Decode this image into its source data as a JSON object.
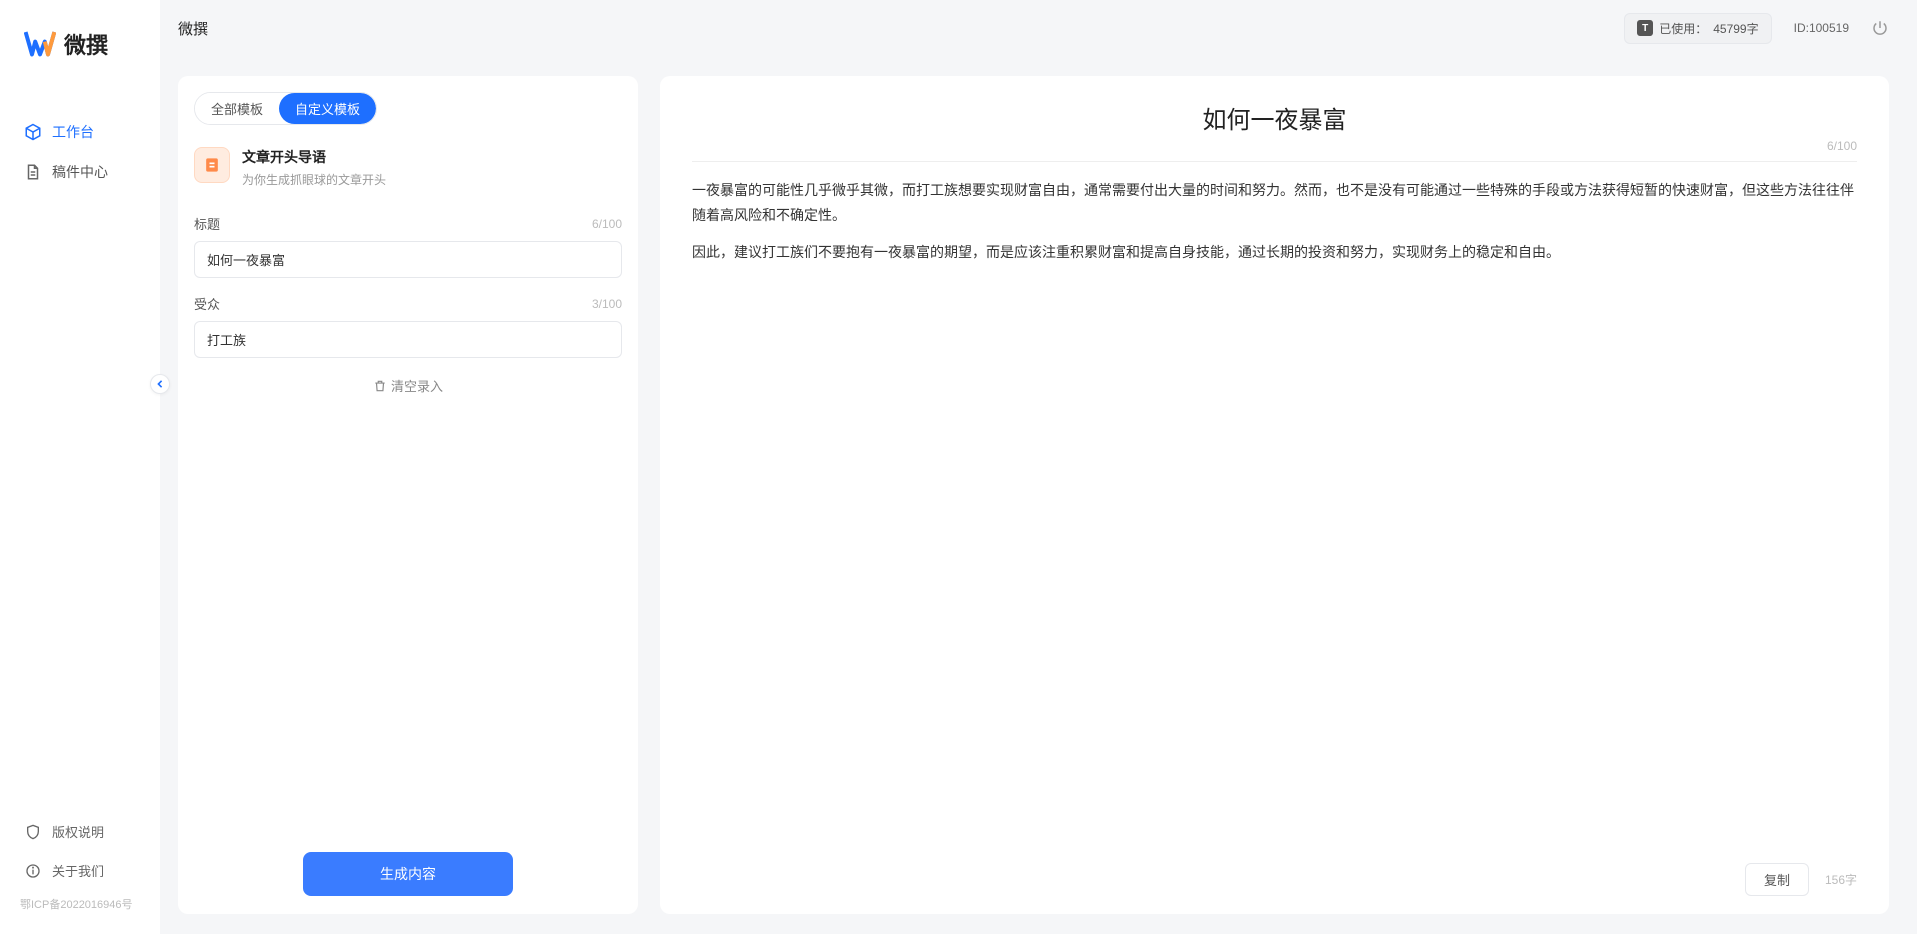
{
  "app_name": "微撰",
  "header": {
    "title": "微撰",
    "usage_label": "已使用：",
    "usage_value": "45799字",
    "user_id_label": "ID:",
    "user_id_value": "100519"
  },
  "sidebar": {
    "items": [
      {
        "label": "工作台",
        "icon": "cube",
        "active": true
      },
      {
        "label": "稿件中心",
        "icon": "document",
        "active": false
      }
    ],
    "bottom": [
      {
        "label": "版权说明",
        "icon": "shield"
      },
      {
        "label": "关于我们",
        "icon": "info"
      }
    ],
    "icp": "鄂ICP备2022016946号"
  },
  "left_panel": {
    "tabs": [
      {
        "label": "全部模板",
        "active": false
      },
      {
        "label": "自定义模板",
        "active": true
      }
    ],
    "template": {
      "title": "文章开头导语",
      "desc": "为你生成抓眼球的文章开头"
    },
    "form": {
      "title_label": "标题",
      "title_counter": "6/100",
      "title_value": "如何一夜暴富",
      "audience_label": "受众",
      "audience_counter": "3/100",
      "audience_value": "打工族",
      "clear_label": "清空录入"
    },
    "generate_button": "生成内容"
  },
  "right_panel": {
    "doc_title": "如何一夜暴富",
    "doc_title_counter": "6/100",
    "paragraphs": [
      "一夜暴富的可能性几乎微乎其微，而打工族想要实现财富自由，通常需要付出大量的时间和努力。然而，也不是没有可能通过一些特殊的手段或方法获得短暂的快速财富，但这些方法往往伴随着高风险和不确定性。",
      "因此，建议打工族们不要抱有一夜暴富的期望，而是应该注重积累财富和提高自身技能，通过长期的投资和努力，实现财务上的稳定和自由。"
    ],
    "copy_button": "复制",
    "word_count": "156字"
  }
}
